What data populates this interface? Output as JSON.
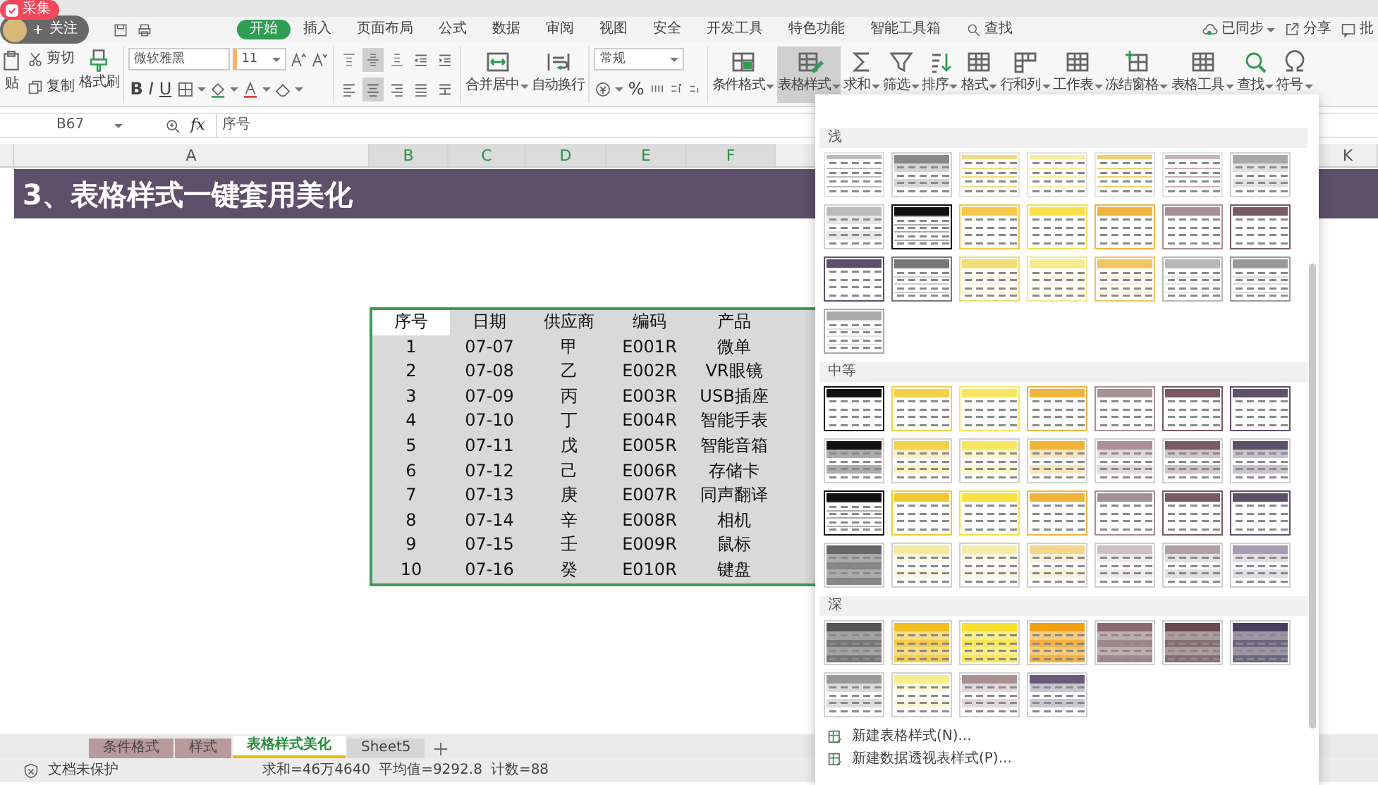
{
  "overlay": {
    "collect": "采集",
    "follow": "关注"
  },
  "menu": [
    {
      "label": "开始",
      "selected": true
    },
    {
      "label": "插入",
      "selected": false
    },
    {
      "label": "页面布局",
      "selected": false
    },
    {
      "label": "公式",
      "selected": false
    },
    {
      "label": "数据",
      "selected": false
    },
    {
      "label": "审阅",
      "selected": false
    },
    {
      "label": "视图",
      "selected": false
    },
    {
      "label": "安全",
      "selected": false
    },
    {
      "label": "开发工具",
      "selected": false
    },
    {
      "label": "特色功能",
      "selected": false
    },
    {
      "label": "智能工具箱",
      "selected": false
    }
  ],
  "menu_search": "查找",
  "menu_right": [
    {
      "label": "已同步",
      "dropdown": true
    },
    {
      "label": "分享",
      "dropdown": false
    },
    {
      "label": "批",
      "dropdown": false
    }
  ],
  "ribbon": {
    "paste": "贴",
    "cut": "剪切",
    "copy": "复制",
    "painter": "格式刷",
    "font_name": "微软雅黑",
    "font_size": "11",
    "styles": [
      "B",
      "I",
      "U"
    ],
    "align_buttons": [
      {
        "selected": false
      },
      {
        "selected": true
      },
      {
        "selected": false
      },
      {
        "selected": false
      },
      {
        "selected": false
      },
      {
        "selected": false
      },
      {
        "selected": true
      },
      {
        "selected": false
      },
      {
        "selected": false
      },
      {
        "selected": false
      }
    ],
    "tools_a": [
      {
        "label": "合并居中",
        "dropdown": true,
        "selected": false
      },
      {
        "label": "自动换行",
        "dropdown": false,
        "selected": false
      }
    ],
    "number_format": "常规",
    "percent": "%",
    "tools_b": [
      {
        "label": "条件格式",
        "dropdown": true,
        "selected": false
      },
      {
        "label": "表格样式",
        "dropdown": true,
        "selected": true
      },
      {
        "label": "求和",
        "dropdown": true,
        "selected": false
      },
      {
        "label": "筛选",
        "dropdown": true,
        "selected": false
      },
      {
        "label": "排序",
        "dropdown": true,
        "selected": false
      },
      {
        "label": "格式",
        "dropdown": true,
        "selected": false
      },
      {
        "label": "行和列",
        "dropdown": true,
        "selected": false
      },
      {
        "label": "工作表",
        "dropdown": true,
        "selected": false
      },
      {
        "label": "冻结窗格",
        "dropdown": true,
        "selected": false
      },
      {
        "label": "表格工具",
        "dropdown": true,
        "selected": false
      },
      {
        "label": "查找",
        "dropdown": true,
        "selected": false
      },
      {
        "label": "符号",
        "dropdown": true,
        "selected": false
      }
    ]
  },
  "formula_bar": {
    "cell": "B67",
    "fx": "fx",
    "content": "序号"
  },
  "columns": [
    "A",
    "B",
    "C",
    "D",
    "E",
    "F",
    "K"
  ],
  "banner": "3、表格样式一键套用美化",
  "table": {
    "headers": [
      {
        "text": "序号",
        "selected": true
      },
      {
        "text": "日期",
        "selected": false
      },
      {
        "text": "供应商",
        "selected": false
      },
      {
        "text": "编码",
        "selected": false
      },
      {
        "text": "产品",
        "selected": false
      }
    ],
    "rows": [
      [
        "1",
        "07-07",
        "甲",
        "E001R",
        "微单"
      ],
      [
        "2",
        "07-08",
        "乙",
        "E002R",
        "VR眼镜"
      ],
      [
        "3",
        "07-09",
        "丙",
        "E003R",
        "USB插座"
      ],
      [
        "4",
        "07-10",
        "丁",
        "E004R",
        "智能手表"
      ],
      [
        "5",
        "07-11",
        "戊",
        "E005R",
        "智能音箱"
      ],
      [
        "6",
        "07-12",
        "己",
        "E006R",
        "存储卡"
      ],
      [
        "7",
        "07-13",
        "庚",
        "E007R",
        "同声翻译"
      ],
      [
        "8",
        "07-14",
        "辛",
        "E008R",
        "相机"
      ],
      [
        "9",
        "07-15",
        "壬",
        "E009R",
        "鼠标"
      ],
      [
        "10",
        "07-16",
        "癸",
        "E010R",
        "键盘"
      ]
    ]
  },
  "gallery": {
    "sections": [
      {
        "title": "浅",
        "styles": [
          {
            "kind": "lines",
            "color": "#bbbbbb"
          },
          {
            "kind": "banded",
            "color": "#888888"
          },
          {
            "kind": "lines",
            "color": "#f0dc80"
          },
          {
            "kind": "lines",
            "color": "#f5ee9a"
          },
          {
            "kind": "lines",
            "color": "#efcf70"
          },
          {
            "kind": "lines",
            "color": "#c4b4b8"
          },
          {
            "kind": "banded",
            "color": "#a8a8a8"
          },
          {
            "kind": "banded",
            "color": "#bbbbbb"
          },
          {
            "kind": "grid",
            "color": "#111111"
          },
          {
            "kind": "header",
            "color": "#f5c84a"
          },
          {
            "kind": "header",
            "color": "#f7e04a"
          },
          {
            "kind": "header",
            "color": "#f0b43a"
          },
          {
            "kind": "header",
            "color": "#a58f94"
          },
          {
            "kind": "header",
            "color": "#7a5a62"
          },
          {
            "kind": "header",
            "color": "#5e4f6b"
          },
          {
            "kind": "grid",
            "color": "#777777"
          },
          {
            "kind": "grid",
            "color": "#f2dc78"
          },
          {
            "kind": "grid",
            "color": "#f5ea8a"
          },
          {
            "kind": "grid",
            "color": "#efc660"
          },
          {
            "kind": "grid",
            "color": "#b8b8b8"
          },
          {
            "kind": "grid",
            "color": "#999999"
          },
          {
            "kind": "grid",
            "color": "#aaaaaa"
          }
        ]
      },
      {
        "title": "中等",
        "styles": [
          {
            "kind": "header",
            "color": "#111111"
          },
          {
            "kind": "header",
            "color": "#f5d04a"
          },
          {
            "kind": "header",
            "color": "#f7e760"
          },
          {
            "kind": "header",
            "color": "#f0b43a"
          },
          {
            "kind": "header",
            "color": "#a89095"
          },
          {
            "kind": "header",
            "color": "#7a5a62"
          },
          {
            "kind": "header",
            "color": "#5e4f6b"
          },
          {
            "kind": "banded",
            "color": "#111111"
          },
          {
            "kind": "banded",
            "color": "#f5d04a"
          },
          {
            "kind": "banded",
            "color": "#f7e760"
          },
          {
            "kind": "banded",
            "color": "#f0b43a"
          },
          {
            "kind": "banded",
            "color": "#a89095"
          },
          {
            "kind": "banded",
            "color": "#7a5a62"
          },
          {
            "kind": "banded",
            "color": "#5e4f6b"
          },
          {
            "kind": "grid",
            "color": "#111111"
          },
          {
            "kind": "header",
            "color": "#f0c830"
          },
          {
            "kind": "header",
            "color": "#f7e040"
          },
          {
            "kind": "header",
            "color": "#f0b43a"
          },
          {
            "kind": "header",
            "color": "#a58f94"
          },
          {
            "kind": "header",
            "color": "#7a5a62"
          },
          {
            "kind": "header",
            "color": "#5e4f6b"
          },
          {
            "kind": "dark",
            "color": "#666666"
          },
          {
            "kind": "banded",
            "color": "#f7e8a0"
          },
          {
            "kind": "banded",
            "color": "#f7eca8"
          },
          {
            "kind": "banded",
            "color": "#f2d68a"
          },
          {
            "kind": "banded",
            "color": "#cdbfc2"
          },
          {
            "kind": "banded",
            "color": "#b0a0a4"
          },
          {
            "kind": "banded",
            "color": "#a89cb4"
          }
        ]
      },
      {
        "title": "深",
        "styles": [
          {
            "kind": "dark",
            "color": "#555555"
          },
          {
            "kind": "dark",
            "color": "#f0c020"
          },
          {
            "kind": "dark",
            "color": "#f7e030"
          },
          {
            "kind": "dark",
            "color": "#f0a010"
          },
          {
            "kind": "dark",
            "color": "#8a6a70"
          },
          {
            "kind": "dark",
            "color": "#6a4a50"
          },
          {
            "kind": "dark",
            "color": "#4a3f5e"
          },
          {
            "kind": "banded",
            "color": "#999999"
          },
          {
            "kind": "banded",
            "color": "#f7ec90"
          },
          {
            "kind": "banded",
            "color": "#a89090"
          },
          {
            "kind": "banded",
            "color": "#6a5a7a"
          }
        ]
      }
    ],
    "menu": [
      "新建表格样式(N)...",
      "新建数据透视表样式(P)..."
    ]
  },
  "sheet_tabs": [
    {
      "label": "条件格式",
      "selected": false,
      "color": "#b89a9a"
    },
    {
      "label": "样式",
      "selected": false,
      "color": "#b89a9a"
    },
    {
      "label": "表格样式美化",
      "selected": true
    },
    {
      "label": "Sheet5",
      "selected": false
    }
  ],
  "status": {
    "protection": "文档未保护",
    "stats": [
      "求和=46万4640",
      "平均值=9292.8",
      "计数=88"
    ]
  }
}
